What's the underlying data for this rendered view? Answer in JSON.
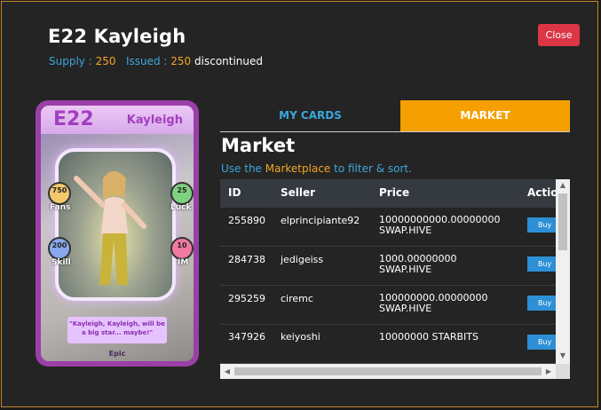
{
  "header": {
    "title": "E22 Kayleigh",
    "supply_label": "Supply :",
    "supply_value": "250",
    "issued_label": "Issued :",
    "issued_value": "250",
    "status": "discontinued",
    "close_label": "Close"
  },
  "card": {
    "code": "E22",
    "name": "Kayleigh",
    "stats": {
      "fans_value": "750",
      "fans_label": "Fans",
      "luck_value": "25",
      "luck_label": "Luck",
      "skill_value": "200",
      "skill_label": "Skill",
      "im_value": "10",
      "im_label": "IM"
    },
    "quote": "\"Kayleigh, Kayleigh, will be a big star... maybe!\"",
    "rarity": "Epic"
  },
  "tabs": {
    "my_cards": "MY CARDS",
    "market": "MARKET"
  },
  "market": {
    "title": "Market",
    "desc_prefix": "Use the",
    "desc_link": "Marketplace",
    "desc_suffix": "to filter & sort.",
    "columns": [
      "ID",
      "Seller",
      "Price",
      "Actio"
    ],
    "buy_label": "Buy",
    "rows": [
      {
        "id": "255890",
        "seller": "elprincipiante92",
        "price_line1": "10000000000.00000000",
        "price_line2": "SWAP.HIVE"
      },
      {
        "id": "284738",
        "seller": "jedigeiss",
        "price_line1": "1000.00000000",
        "price_line2": "SWAP.HIVE"
      },
      {
        "id": "295259",
        "seller": "ciremc",
        "price_line1": "100000000.00000000",
        "price_line2": "SWAP.HIVE"
      },
      {
        "id": "347926",
        "seller": "keiyoshi",
        "price_line1": "10000000 STARBITS",
        "price_line2": ""
      }
    ]
  },
  "colors": {
    "accent_orange": "#f5a000",
    "accent_blue": "#3ba7dc",
    "close_red": "#dc3545",
    "buy_blue": "#2d8fd5"
  }
}
